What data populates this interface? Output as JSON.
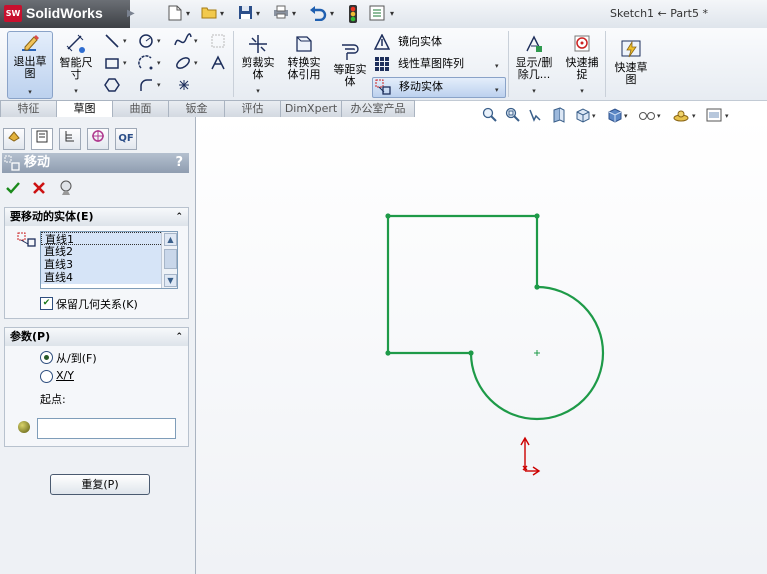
{
  "app": {
    "brand": "SolidWorks",
    "brand_badge": "SW",
    "window_title": "Sketch1 ← Part5 *"
  },
  "colors": {
    "sketch_line": "#1e9a48",
    "origin": "#cc0000",
    "accent_ok": "#1b8a1b",
    "accent_cancel": "#cc1111"
  },
  "quick_access": [
    "new-icon",
    "open-icon",
    "save-icon",
    "print-icon",
    "undo-icon",
    "rebuild-icon",
    "options-icon"
  ],
  "ribbon": {
    "exit_sketch": "退出草\n图",
    "smart_dim": "智能尺\n寸",
    "trim": "剪裁实\n体",
    "convert": "转换实\n体引用",
    "offset": "等距实\n体",
    "mirror": "镜向实体",
    "linear_pattern": "线性草图阵列",
    "move_entities": "移动实体",
    "show_delete": "显示/删\n除几...",
    "quick_snap": "快速捕\n捉",
    "rapid_sketch": "快速草\n图"
  },
  "tabs": [
    {
      "label": "特征",
      "active": false
    },
    {
      "label": "草图",
      "active": true
    },
    {
      "label": "曲面",
      "active": false
    },
    {
      "label": "钣金",
      "active": false
    },
    {
      "label": "评估",
      "active": false
    },
    {
      "label": "DimXpert",
      "active": false
    },
    {
      "label": "办公室产品",
      "active": false
    }
  ],
  "panel_tabs": [
    "feature-manager-icon",
    "property-manager-icon",
    "configuration-manager-icon",
    "dim-xpert-icon",
    "qf-icon"
  ],
  "panel_tab_qf": "QF",
  "property_manager": {
    "title": "移动",
    "help": "?",
    "entities_group": {
      "title": "要移动的实体(E)",
      "items": [
        "直线1",
        "直线2",
        "直线3",
        "直线4"
      ],
      "keep_relations": "保留几何关系(K)",
      "keep_relations_checked": true
    },
    "params_group": {
      "title": "参数(P)",
      "options": [
        "从/到(F)",
        "X/Y"
      ],
      "selected": "从/到(F)",
      "start_label": "起点:",
      "start_value": ""
    },
    "reset_button": "重复(P)"
  }
}
